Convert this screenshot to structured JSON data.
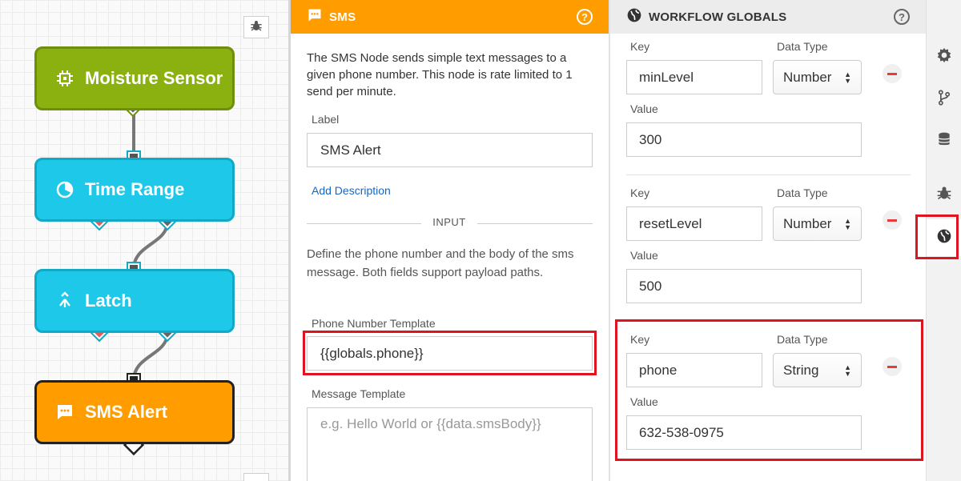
{
  "canvas": {
    "nodes": [
      {
        "label": "Moisture Sensor",
        "icon": "chip-icon"
      },
      {
        "label": "Time Range",
        "icon": "clock-icon"
      },
      {
        "label": "Latch",
        "icon": "merge-icon"
      },
      {
        "label": "SMS Alert",
        "icon": "message-icon"
      }
    ],
    "colors": {
      "sensor": "#8ab110",
      "logic": "#1ec8e8",
      "output": "#ff9c00"
    }
  },
  "sms_panel": {
    "title": "SMS",
    "description": "The SMS Node sends simple text messages to a given phone number. This node is rate limited to 1 send per minute.",
    "label_field": {
      "label": "Label",
      "value": "SMS Alert"
    },
    "add_description": "Add Description",
    "divider": "INPUT",
    "input_description": "Define the phone number and the body of the sms message. Both fields support payload paths.",
    "phone_field": {
      "label": "Phone Number Template",
      "value": "{{globals.phone}}"
    },
    "message_field": {
      "label": "Message Template",
      "placeholder": "e.g. Hello World or {{data.smsBody}}"
    }
  },
  "globals_panel": {
    "title": "WORKFLOW GLOBALS",
    "key_label": "Key",
    "type_label": "Data Type",
    "value_label": "Value",
    "globals": [
      {
        "key": "minLevel",
        "type": "Number",
        "value": "300"
      },
      {
        "key": "resetLevel",
        "type": "Number",
        "value": "500"
      },
      {
        "key": "phone",
        "type": "String",
        "value": "632-538-0975"
      }
    ]
  },
  "sidebar": {
    "items": [
      "gear-icon",
      "branch-icon",
      "database-icon",
      "bug-icon",
      "globe-icon"
    ],
    "active": "globe-icon"
  }
}
